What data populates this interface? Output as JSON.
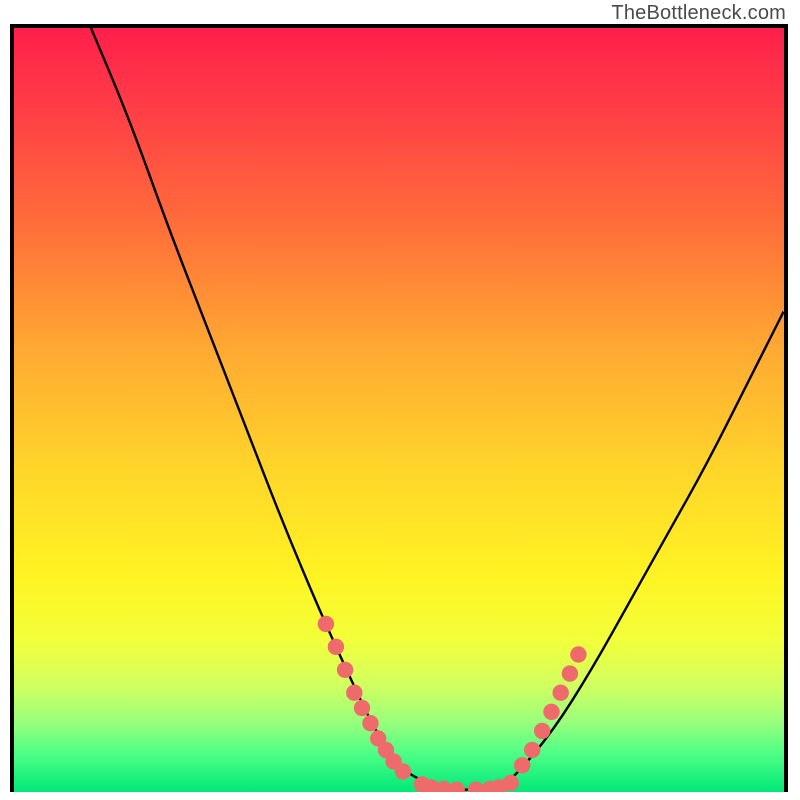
{
  "watermark": "TheBottleneck.com",
  "chart_data": {
    "type": "line",
    "title": "",
    "xlabel": "",
    "ylabel": "",
    "xlim": [
      0,
      100
    ],
    "ylim": [
      0,
      100
    ],
    "grid": false,
    "legend": false,
    "note": "Axes have no visible tick labels; x/y expressed as 0–100% of plot area.",
    "series": [
      {
        "name": "curve",
        "x": [
          10,
          15,
          20,
          25,
          30,
          35,
          40,
          45,
          47,
          50,
          55,
          57,
          60,
          63,
          65,
          70,
          75,
          80,
          85,
          90,
          95,
          100
        ],
        "y": [
          100,
          88,
          74,
          61,
          48,
          35,
          23,
          12,
          8,
          3,
          0.5,
          0.3,
          0.3,
          0.6,
          2,
          8,
          16,
          25,
          34,
          43,
          53,
          63
        ]
      }
    ],
    "markers": {
      "name": "highlight-dots",
      "color": "#ef6a6a",
      "points": [
        {
          "x": 40.5,
          "y": 22
        },
        {
          "x": 41.8,
          "y": 19
        },
        {
          "x": 43.0,
          "y": 16
        },
        {
          "x": 44.2,
          "y": 13
        },
        {
          "x": 45.2,
          "y": 11
        },
        {
          "x": 46.3,
          "y": 9
        },
        {
          "x": 47.3,
          "y": 7
        },
        {
          "x": 48.3,
          "y": 5.5
        },
        {
          "x": 49.3,
          "y": 4
        },
        {
          "x": 50.5,
          "y": 2.7
        },
        {
          "x": 53.0,
          "y": 1.0
        },
        {
          "x": 54.2,
          "y": 0.6
        },
        {
          "x": 55.8,
          "y": 0.4
        },
        {
          "x": 57.5,
          "y": 0.3
        },
        {
          "x": 60.0,
          "y": 0.3
        },
        {
          "x": 61.8,
          "y": 0.4
        },
        {
          "x": 63.0,
          "y": 0.6
        },
        {
          "x": 64.5,
          "y": 1.2
        },
        {
          "x": 66.0,
          "y": 3.5
        },
        {
          "x": 67.3,
          "y": 5.5
        },
        {
          "x": 68.6,
          "y": 8
        },
        {
          "x": 69.8,
          "y": 10.5
        },
        {
          "x": 71.0,
          "y": 13
        },
        {
          "x": 72.2,
          "y": 15.5
        },
        {
          "x": 73.3,
          "y": 18
        }
      ]
    },
    "background_gradient": {
      "direction": "vertical",
      "stops": [
        {
          "pos": 0.0,
          "color": "#ff1f4b"
        },
        {
          "pos": 0.25,
          "color": "#ff6b3a"
        },
        {
          "pos": 0.55,
          "color": "#ffd62a"
        },
        {
          "pos": 0.8,
          "color": "#f3ff3a"
        },
        {
          "pos": 0.95,
          "color": "#4dff86"
        },
        {
          "pos": 1.0,
          "color": "#00e879"
        }
      ]
    }
  }
}
